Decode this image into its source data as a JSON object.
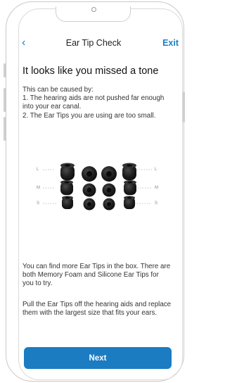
{
  "nav": {
    "back_icon": "chevron-left-icon",
    "back_glyph": "‹",
    "title": "Ear Tip Check",
    "exit_label": "Exit"
  },
  "heading": "It looks like you missed a tone",
  "cause": {
    "intro": "This can be caused by:",
    "reason_1": "1. The hearing aids are not pushed far enough into your ear canal.",
    "reason_2": "2. The Ear Tips you are using are too small."
  },
  "illustration": {
    "left_labels": [
      "L",
      "M",
      "S"
    ],
    "right_labels": [
      "L",
      "M",
      "S"
    ]
  },
  "info": {
    "paragraph_1": "You can find more Ear Tips in the box. There are both Memory Foam and Silicone Ear Tips for you to try.",
    "paragraph_2": "Pull the Ear Tips off the hearing aids and replace them with the largest size that fits your ears."
  },
  "next_label": "Next",
  "colors": {
    "accent": "#1b7cc2",
    "link": "#1a7fc6",
    "ear_tip": "#1e1e1e"
  }
}
